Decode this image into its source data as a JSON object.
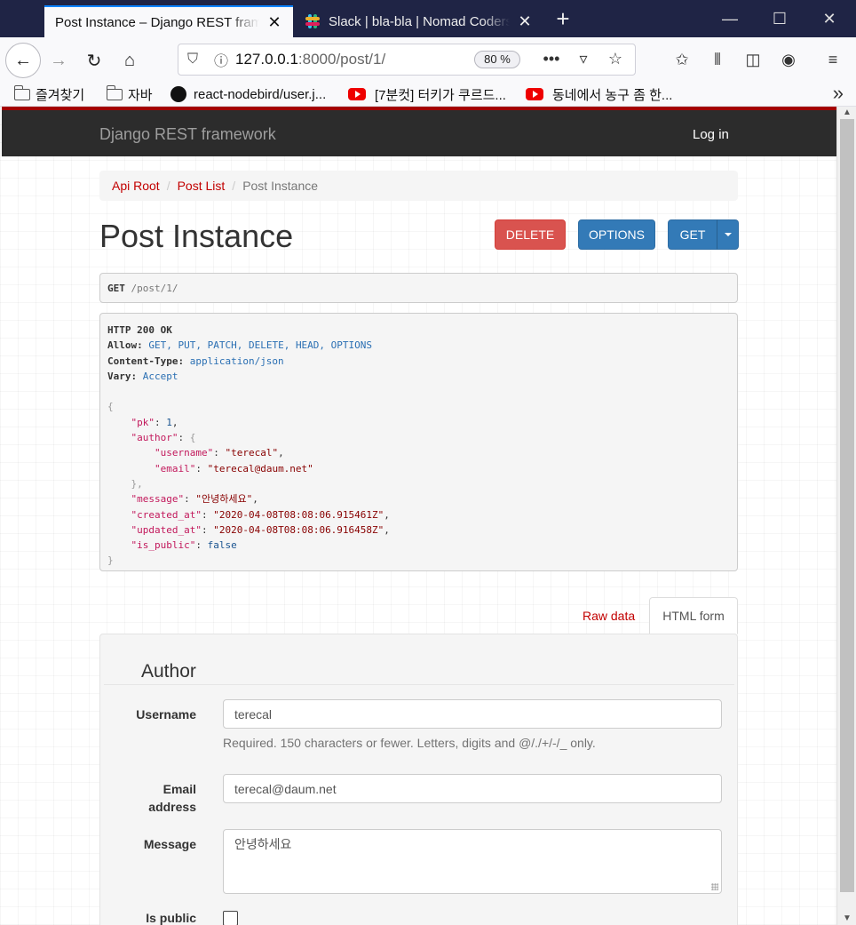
{
  "browser": {
    "tabs": [
      {
        "title": "Post Instance – Django REST framework",
        "active": true
      },
      {
        "title": "Slack | bla-bla | Nomad Coders",
        "active": false
      }
    ],
    "url_host": "127.0.0.1",
    "url_rest": ":8000/post/1/",
    "zoom": "80 %",
    "bookmarks": [
      {
        "label": "즐겨찾기",
        "icon": "folder-icon"
      },
      {
        "label": "자바",
        "icon": "folder-icon"
      },
      {
        "label": "react-nodebird/user.j...",
        "icon": "github-icon"
      },
      {
        "label": "[7분컷] 터키가 쿠르드...",
        "icon": "youtube-icon"
      },
      {
        "label": "동네에서 농구 좀 한...",
        "icon": "youtube-icon"
      }
    ],
    "accent_color": "#0a84ff"
  },
  "drf": {
    "brand": "Django REST framework",
    "login": "Log in",
    "breadcrumb": [
      "Api Root",
      "Post List",
      "Post Instance"
    ],
    "title": "Post Instance",
    "buttons": {
      "delete": "DELETE",
      "options": "OPTIONS",
      "get": "GET"
    },
    "request": {
      "method": "GET",
      "path": "/post/1/"
    },
    "response": {
      "status": "HTTP 200 OK",
      "headers": [
        {
          "name": "Allow:",
          "value": "GET, PUT, PATCH, DELETE, HEAD, OPTIONS"
        },
        {
          "name": "Content-Type:",
          "value": "application/json"
        },
        {
          "name": "Vary:",
          "value": "Accept"
        }
      ],
      "body": {
        "pk": "1",
        "author": "\"author\"",
        "username_key": "\"username\"",
        "username": "\"terecal\"",
        "email_key": "\"email\"",
        "email": "\"terecal@daum.net\"",
        "message": "\"안녕하세요\"",
        "created_at": "\"2020-04-08T08:08:06.915461Z\"",
        "updated_at": "\"2020-04-08T08:08:06.916458Z\"",
        "is_public": "false"
      }
    },
    "form_tabs": {
      "raw": "Raw data",
      "html": "HTML form"
    },
    "form": {
      "legend": "Author",
      "username_label": "Username",
      "username_value": "terecal",
      "username_help": "Required. 150 characters or fewer. Letters, digits and @/./+/-/_ only.",
      "email_label_1": "Email",
      "email_label_2": "address",
      "email_value": "terecal@daum.net",
      "message_label": "Message",
      "message_value": "안녕하세요",
      "is_public_label": "Is public"
    },
    "colors": {
      "navbar": "#2c2c2c",
      "brand_red": "#a30000",
      "delete": "#d9534f",
      "primary": "#337ab7"
    }
  }
}
